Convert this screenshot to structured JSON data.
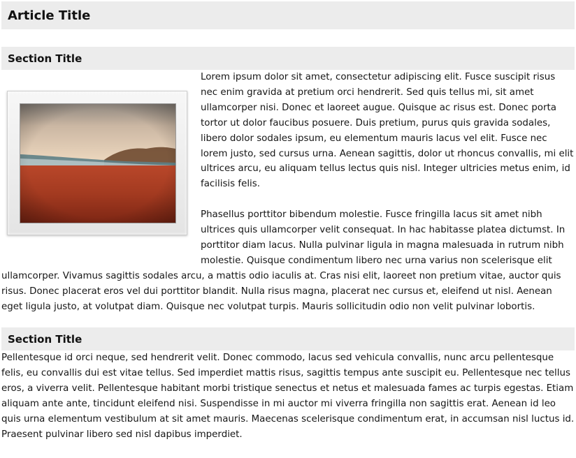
{
  "article": {
    "title": "Article Title"
  },
  "sections": [
    {
      "title": "Section Title",
      "image": {
        "name": "desert-landscape-thumbnail"
      },
      "paragraphs": [
        "Lorem ipsum dolor sit amet, consectetur adipiscing elit. Fusce suscipit risus nec enim gravida at pretium orci hendrerit. Sed quis tellus mi, sit amet ullamcorper nisi. Donec et laoreet augue. Quisque ac risus est. Donec porta tortor ut dolor faucibus posuere. Duis pretium, purus quis gravida sodales, libero dolor sodales ipsum, eu elementum mauris lacus vel elit. Fusce nec lorem justo, sed cursus urna. Aenean sagittis, dolor ut rhoncus convallis, mi elit ultrices arcu, eu aliquam tellus lectus quis nisl. Integer ultricies metus enim, id facilisis felis.",
        "Phasellus porttitor bibendum molestie. Fusce fringilla lacus sit amet nibh ultrices quis ullamcorper velit consequat. In hac habitasse platea dictumst. In porttitor diam lacus. Nulla pulvinar ligula in magna malesuada in rutrum nibh molestie. Quisque condimentum libero nec urna varius non scelerisque elit ullamcorper. Vivamus sagittis sodales arcu, a mattis odio iaculis at. Cras nisi elit, laoreet non pretium vitae, auctor quis risus. Donec placerat eros vel dui porttitor blandit. Nulla risus magna, placerat nec cursus et, eleifend ut nisl. Aenean eget ligula justo, at volutpat diam. Quisque nec volutpat turpis. Mauris sollicitudin odio non velit pulvinar lobortis."
      ]
    },
    {
      "title": "Section Title",
      "paragraphs": [
        "Pellentesque id orci neque, sed hendrerit velit. Donec commodo, lacus sed vehicula convallis, nunc arcu pellentesque felis, eu convallis dui est vitae tellus. Sed imperdiet mattis risus, sagittis tempus ante suscipit eu. Pellentesque nec tellus eros, a viverra velit. Pellentesque habitant morbi tristique senectus et netus et malesuada fames ac turpis egestas. Etiam aliquam ante ante, tincidunt eleifend nisi. Suspendisse in mi auctor mi viverra fringilla non sagittis erat. Aenean id leo quis urna elementum vestibulum at sit amet mauris. Maecenas scelerisque condimentum erat, in accumsan nisl luctus id. Praesent pulvinar libero sed nisl dapibus imperdiet."
      ]
    }
  ],
  "colors": {
    "header_background": "#ececec",
    "text": "#151515",
    "sand": "#a33a20",
    "sky": "#f3e2cc"
  }
}
